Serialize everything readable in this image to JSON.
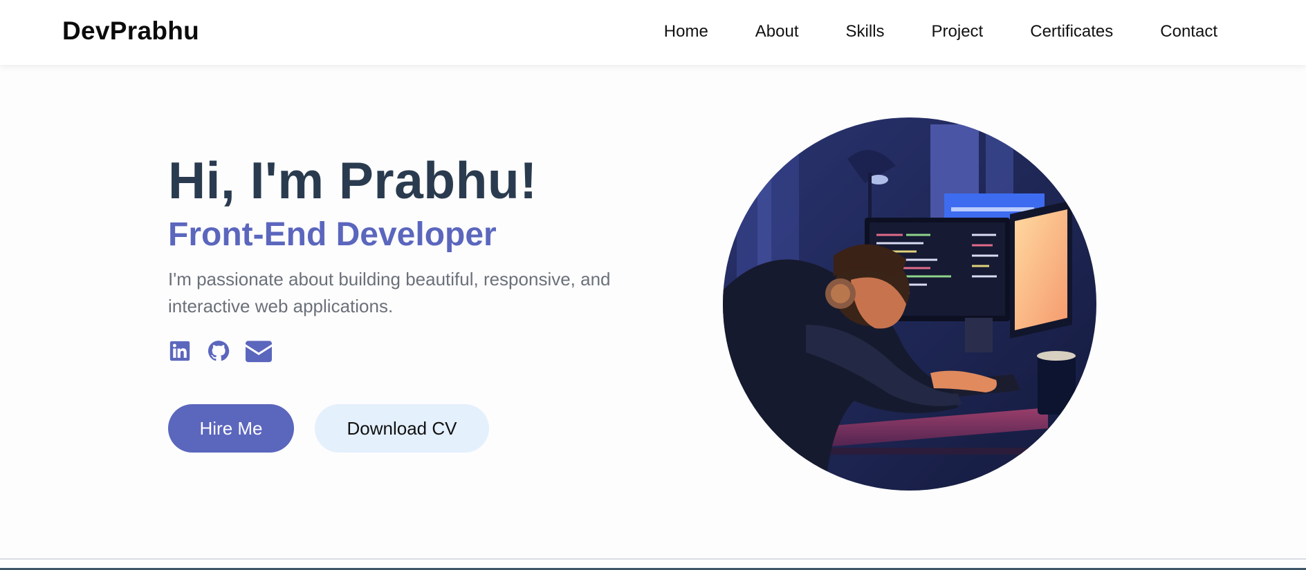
{
  "brand": "DevPrabhu",
  "nav": {
    "items": [
      "Home",
      "About",
      "Skills",
      "Project",
      "Certificates",
      "Contact"
    ]
  },
  "hero": {
    "title": "Hi, I'm Prabhu!",
    "role": "Front-End Developer",
    "description": "I'm passionate about building beautiful, responsive, and interactive web applications.",
    "socials": [
      "linkedin-icon",
      "github-icon",
      "mail-icon"
    ],
    "buttons": {
      "hire": "Hire Me",
      "download": "Download CV"
    }
  },
  "colors": {
    "accent": "#5b66bd",
    "title": "#2a3b4f",
    "secondary_button": "#e4f0fc"
  }
}
